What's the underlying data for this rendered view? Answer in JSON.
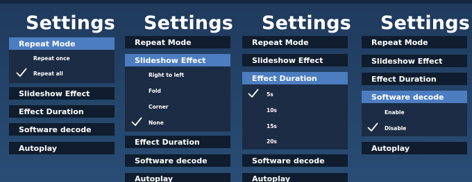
{
  "title": "Settings",
  "menu": {
    "repeat_mode": "Repeat Mode",
    "slideshow_effect": "Slideshow Effect",
    "effect_duration": "Effect Duration",
    "software_decode": "Software decode",
    "autoplay": "Autoplay"
  },
  "repeat_options": [
    "Repeat once",
    "Repeat all"
  ],
  "repeat_selected": "Repeat all",
  "slideshow_options": [
    "Right to left",
    "Fold",
    "Corner",
    "None"
  ],
  "slideshow_selected": "None",
  "duration_options": [
    "5s",
    "10s",
    "15s",
    "20s"
  ],
  "duration_selected": "5s",
  "decode_options": [
    "Enable",
    "Disable"
  ],
  "decode_selected": "Disable",
  "colors": {
    "background": "#244469",
    "item": "#0f1d2e",
    "active": "#4c7dc1",
    "submenu": "#1b2c44"
  },
  "icons": {
    "check": "check-icon"
  }
}
